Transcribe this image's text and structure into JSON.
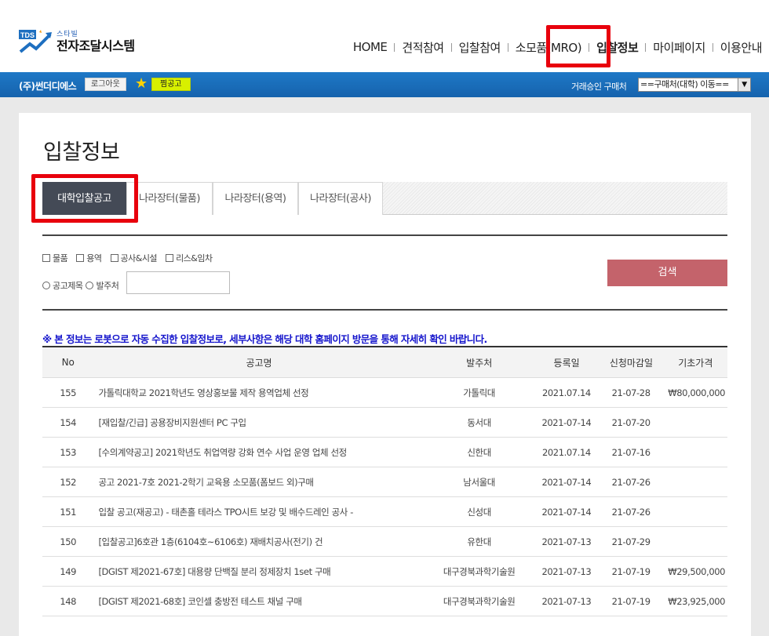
{
  "logo": {
    "sub": "스타빌",
    "main": "전자조달시스템",
    "mark": "TDS"
  },
  "nav": {
    "items": [
      {
        "label": "HOME"
      },
      {
        "label": "견적참여"
      },
      {
        "label": "입찰참여"
      },
      {
        "label": "소모품(MRO)"
      },
      {
        "label": "입찰정보"
      },
      {
        "label": "마이페이지"
      },
      {
        "label": "이용안내"
      }
    ]
  },
  "topbar": {
    "company": "(주)썬더디에스",
    "logout": "로그아웃",
    "favorite": "찜공고",
    "buyer_label": "거래승인 구매처",
    "buyer_select": "==구매처(대학) 이동=="
  },
  "page": {
    "title": "입찰정보"
  },
  "tabs": [
    {
      "label": "대학입찰공고"
    },
    {
      "label": "나라장터(물품)"
    },
    {
      "label": "나라장터(용역)"
    },
    {
      "label": "나라장터(공사)"
    }
  ],
  "filters": {
    "categories": [
      "물품",
      "용역",
      "공사&시설",
      "리스&임차"
    ],
    "search_types": [
      "공고제목",
      "발주처"
    ],
    "search_value": "",
    "search_button": "검색"
  },
  "notice": "※ 본 정보는 로봇으로 자동 수집한 입찰정보로, 세부사항은 해당 대학 홈페이지 방문을 통해 자세히 확인 바랍니다.",
  "table": {
    "headers": {
      "no": "No",
      "title": "공고명",
      "org": "발주처",
      "reg": "등록일",
      "due": "신청마감일",
      "price": "기초가격"
    },
    "rows": [
      {
        "no": "155",
        "title": "가톨릭대학교 2021학년도 영상홍보물 제작 용역업체 선정",
        "org": "가톨릭대",
        "reg": "2021.07.14",
        "due": "21-07-28",
        "price": "₩80,000,000"
      },
      {
        "no": "154",
        "title": "[재입찰/긴급] 공용장비지원센터 PC 구입",
        "org": "동서대",
        "reg": "2021-07-14",
        "due": "21-07-20",
        "price": ""
      },
      {
        "no": "153",
        "title": "[수의계약공고] 2021학년도 취업역량 강화 연수 사업 운영 업체 선정",
        "org": "신한대",
        "reg": "2021.07.14",
        "due": "21-07-16",
        "price": ""
      },
      {
        "no": "152",
        "title": "공고 2021-7호 2021-2학기 교육용 소모품(폼보드 외)구매",
        "org": "남서울대",
        "reg": "2021-07-14",
        "due": "21-07-26",
        "price": ""
      },
      {
        "no": "151",
        "title": "입찰 공고(재공고) - 태촌홀 테라스 TPO시트 보강 및 배수드레인 공사 -",
        "org": "신성대",
        "reg": "2021-07-14",
        "due": "21-07-26",
        "price": ""
      },
      {
        "no": "150",
        "title": "[입찰공고]6호관 1층(6104호~6106호) 재배치공사(전기) 건",
        "org": "유한대",
        "reg": "2021-07-13",
        "due": "21-07-29",
        "price": ""
      },
      {
        "no": "149",
        "title": "[DGIST 제2021-67호] 대용량 단백질 분리 정제장치 1set 구매",
        "org": "대구경북과학기술원",
        "reg": "2021-07-13",
        "due": "21-07-19",
        "price": "₩29,500,000"
      },
      {
        "no": "148",
        "title": "[DGIST 제2021-68호] 코인셀 충방전 테스트 채널 구매",
        "org": "대구경북과학기술원",
        "reg": "2021-07-13",
        "due": "21-07-19",
        "price": "₩23,925,000"
      }
    ]
  }
}
